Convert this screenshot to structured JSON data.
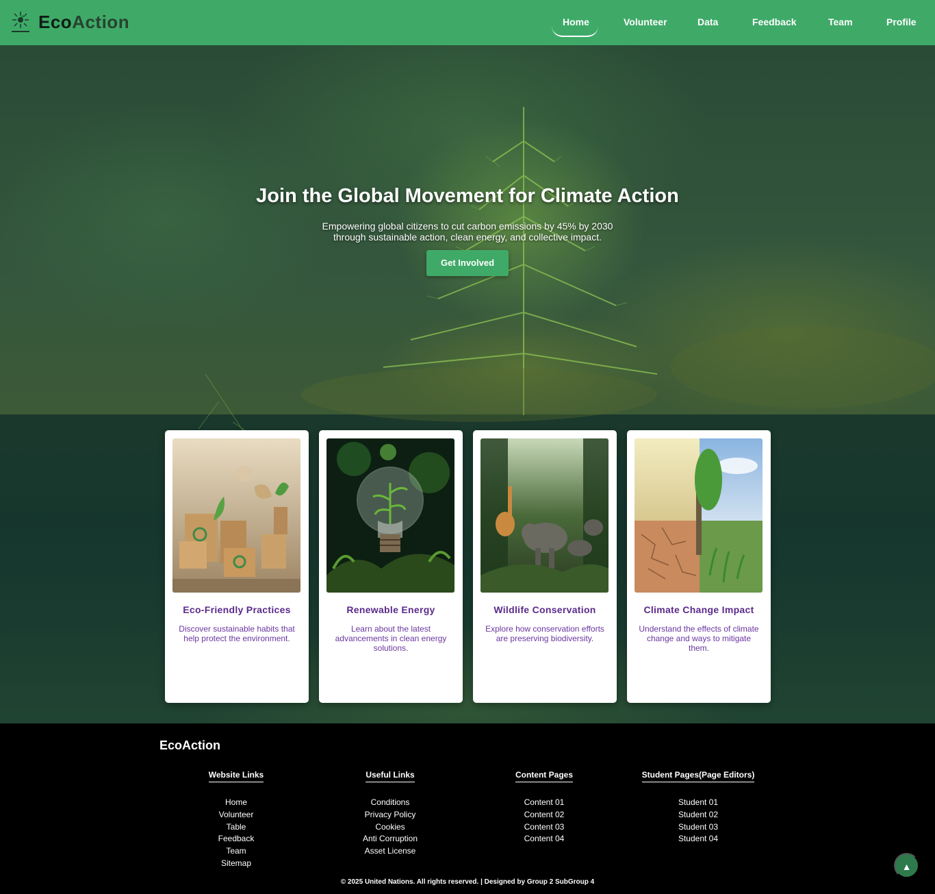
{
  "brand": {
    "name_part1": "Eco",
    "name_part2": "Action"
  },
  "nav": {
    "items": [
      {
        "label": "Home",
        "active": true
      },
      {
        "label": "Volunteer"
      },
      {
        "label": "Data"
      },
      {
        "label": "Feedback"
      },
      {
        "label": "Team"
      },
      {
        "label": "Profile"
      }
    ]
  },
  "hero": {
    "title": "Join the Global Movement for Climate Action",
    "subtitle_line1": "Empowering global citizens to cut carbon emissions by 45% by 2030",
    "subtitle_line2": "through sustainable action, clean energy, and collective impact.",
    "cta_label": "Get Involved"
  },
  "cards": [
    {
      "title": "Eco-Friendly Practices",
      "text": "Discover sustainable habits that help protect the environment.",
      "image_icon": "eco-products-image"
    },
    {
      "title": "Renewable Energy",
      "text": "Learn about the latest advancements in clean energy solutions.",
      "image_icon": "lightbulb-plant-image"
    },
    {
      "title": "Wildlife Conservation",
      "text": "Explore how conservation efforts are preserving biodiversity.",
      "image_icon": "jungle-animals-image"
    },
    {
      "title": "Climate Change Impact",
      "text": "Understand the effects of climate change and ways to mitigate them.",
      "image_icon": "drought-tree-image"
    }
  ],
  "footer": {
    "brand": "EcoAction",
    "columns": [
      {
        "title": "Website Links",
        "links": [
          "Home",
          "Volunteer",
          "Table",
          "Feedback",
          "Team",
          "Sitemap"
        ]
      },
      {
        "title": "Useful Links",
        "links": [
          "Conditions",
          "Privacy Policy",
          "Cookies",
          "Anti Corruption",
          "Asset License"
        ]
      },
      {
        "title": "Content Pages",
        "links": [
          "Content 01",
          "Content 02",
          "Content 03",
          "Content 04"
        ]
      },
      {
        "title": "Student Pages(Page Editors)",
        "links": [
          "Student 01",
          "Student 02",
          "Student 03",
          "Student 04"
        ]
      }
    ],
    "copyright": "© 2025 United Nations. All rights reserved. | Designed by Group 2 SubGroup 4"
  },
  "scroll_top_icon": "▲",
  "colors": {
    "primary_green": "#3faa68",
    "card_title_purple": "#5a2a8a",
    "footer_bg": "#000000"
  }
}
